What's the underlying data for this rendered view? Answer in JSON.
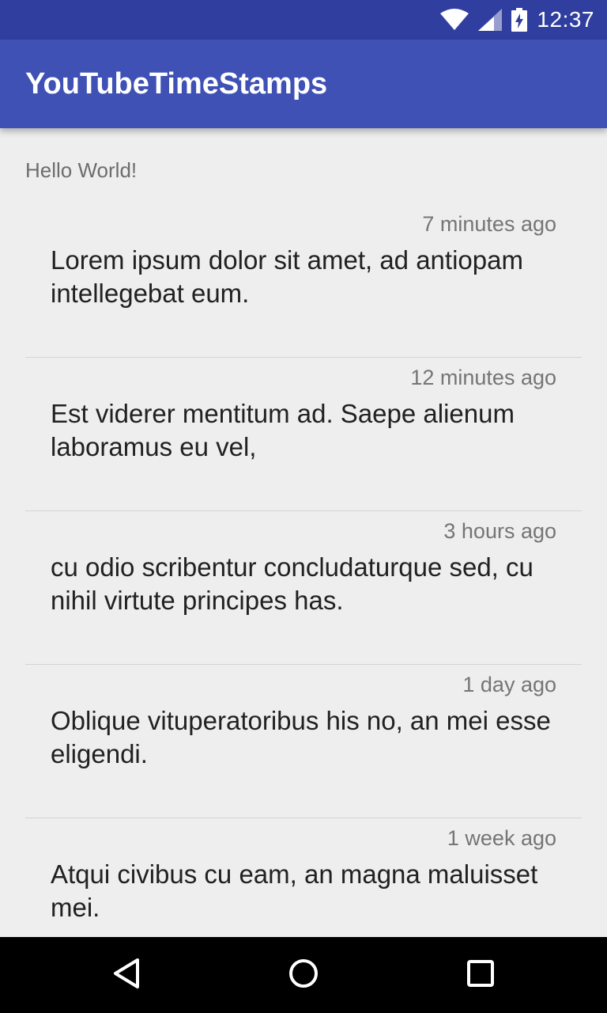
{
  "status_bar": {
    "time": "12:37",
    "icons": [
      "wifi-icon",
      "signal-icon",
      "battery-charging-icon"
    ]
  },
  "app_bar": {
    "title": "YouTubeTimeStamps"
  },
  "content": {
    "hello_text": "Hello World!",
    "items": [
      {
        "time": "7 minutes ago",
        "text": "Lorem ipsum dolor sit amet, ad antiopam intellegebat eum."
      },
      {
        "time": "12 minutes ago",
        "text": "Est viderer mentitum ad. Saepe alienum laboramus eu vel,"
      },
      {
        "time": "3 hours ago",
        "text": "cu odio scribentur concludaturque sed, cu nihil virtute principes has."
      },
      {
        "time": "1 day ago",
        "text": "Oblique vituperatoribus his no, an mei esse eligendi."
      },
      {
        "time": "1 week ago",
        "text": "Atqui civibus cu eam, an magna maluisset mei."
      }
    ]
  },
  "nav_bar": {
    "icons": [
      "back-icon",
      "home-icon",
      "recents-icon"
    ]
  },
  "colors": {
    "status_bar": "#303f9f",
    "app_bar": "#3f51b5",
    "background": "#eeeeee"
  }
}
